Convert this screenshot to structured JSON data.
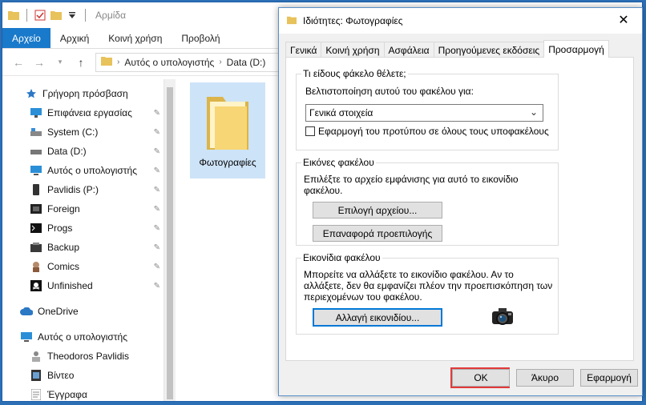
{
  "explorer": {
    "title": "Αρμίδα",
    "ribbon_tabs": [
      "Αρχείο",
      "Αρχική",
      "Κοινή χρήση",
      "Προβολή"
    ],
    "address": {
      "crumbs": [
        "Αυτός ο υπολογιστής",
        "Data (D:)"
      ]
    },
    "nav_items": [
      {
        "label": "Γρήγορη πρόσβαση",
        "icon": "star-icon",
        "pinned": false
      },
      {
        "label": "Επιφάνεια εργασίας",
        "icon": "desktop-icon",
        "pinned": true
      },
      {
        "label": "System (C:)",
        "icon": "drive-icon",
        "pinned": true
      },
      {
        "label": "Data (D:)",
        "icon": "drive-icon",
        "pinned": true
      },
      {
        "label": "Αυτός ο υπολογιστής",
        "icon": "computer-icon",
        "pinned": true
      },
      {
        "label": "Pavlidis (P:)",
        "icon": "phone-icon",
        "pinned": true
      },
      {
        "label": "Foreign",
        "icon": "film-icon",
        "pinned": true
      },
      {
        "label": "Progs",
        "icon": "terminal-icon",
        "pinned": true
      },
      {
        "label": "Backup",
        "icon": "backup-icon",
        "pinned": true
      },
      {
        "label": "Comics",
        "icon": "comics-icon",
        "pinned": true
      },
      {
        "label": "Unfinished",
        "icon": "pirate-icon",
        "pinned": true
      },
      {
        "label": "OneDrive",
        "icon": "cloud-icon",
        "pinned": false
      },
      {
        "label": "Αυτός ο υπολογιστής",
        "icon": "computer-icon",
        "pinned": false
      },
      {
        "label": "Theodoros Pavlidis",
        "icon": "user-folder-icon",
        "pinned": false
      },
      {
        "label": "Βίντεο",
        "icon": "video-icon",
        "pinned": false
      },
      {
        "label": "Έγγραφα",
        "icon": "documents-icon",
        "pinned": false
      }
    ],
    "folder_tile": {
      "label": "Φωτογραφίες"
    }
  },
  "dialog": {
    "title": "Ιδιότητες: Φωτογραφίες",
    "tabs": [
      "Γενικά",
      "Κοινή χρήση",
      "Ασφάλεια",
      "Προηγούμενες εκδόσεις",
      "Προσαρμογή"
    ],
    "active_tab": "Προσαρμογή",
    "group_type": {
      "title": "Τι είδους φάκελο θέλετε;",
      "optimize_label": "Βελτιστοποίηση αυτού του φακέλου για:",
      "select_value": "Γενικά στοιχεία",
      "apply_template_label": "Εφαρμογή του προτύπου σε όλους τους υποφακέλους",
      "apply_template_checked": false
    },
    "group_pictures": {
      "title": "Εικόνες φακέλου",
      "desc_line1": "Επιλέξτε το αρχείο εμφάνισης για αυτό το εικονίδιο",
      "desc_line2": "φακέλου.",
      "choose_file_button": "Επιλογή αρχείου...",
      "restore_default_button": "Επαναφορά προεπιλογής"
    },
    "group_icons": {
      "title": "Εικονίδια φακέλου",
      "desc_line1": "Μπορείτε να αλλάξετε το εικονίδιο φακέλου. Αν το",
      "desc_line2": "αλλάξετε, δεν θα εμφανίζει πλέον την προεπισκόπηση των",
      "desc_line3": "περιεχομένων του φακέλου.",
      "change_icon_button": "Αλλαγή εικονιδίου..."
    },
    "footer": {
      "ok": "OK",
      "cancel": "Άκυρο",
      "apply": "Εφαρμογή"
    }
  },
  "colors": {
    "ribbon_active": "#1979ca",
    "ok_highlight": "#e23a3a",
    "folder_yellow": "#f7d675"
  }
}
